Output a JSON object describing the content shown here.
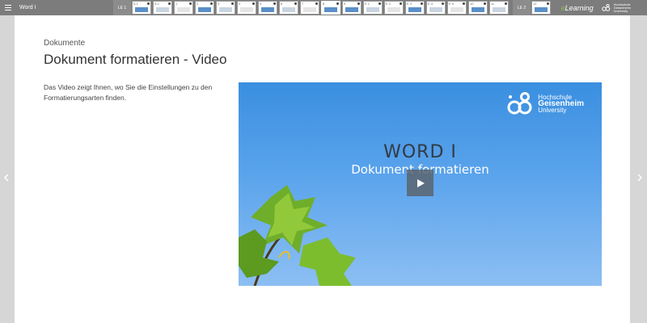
{
  "topbar": {
    "app_title": "Word I",
    "le1_label": "LE 1",
    "le2_label": "LE 2",
    "thumbs_group1": [
      "A 1",
      "A 2",
      "1",
      "2",
      "3",
      "4",
      "5",
      "6",
      "7",
      "8"
    ],
    "thumbs_group2": [
      "9",
      "E 1",
      "E 2",
      "E 3",
      "E 4",
      "E 5",
      "10",
      "11"
    ],
    "thumbs_group3": [
      "12"
    ],
    "brand_e": "e",
    "brand_learning": "Learning",
    "brand_hgu": [
      "Hochschule",
      "Geisenheim",
      "University"
    ]
  },
  "page": {
    "breadcrumb": "Dokumente",
    "title": "Dokument formatieren - Video",
    "description": "Das Video zeigt Ihnen, wo Sie die Einstellungen zu den Formatierungsarten finden."
  },
  "video": {
    "logo_line1": "Hochschule",
    "logo_line2": "Geisenheim",
    "logo_line3": "University",
    "heading": "WORD I",
    "subheading": "Dokument formatieren"
  },
  "colors": {
    "topbar": "#7c7c7c",
    "accent_green": "#8dc63f",
    "video_blue": "#3a8fe0"
  },
  "icons": {
    "menu": "hamburger-icon",
    "play": "play-icon",
    "prev": "chevron-left-icon",
    "next": "chevron-right-icon"
  }
}
